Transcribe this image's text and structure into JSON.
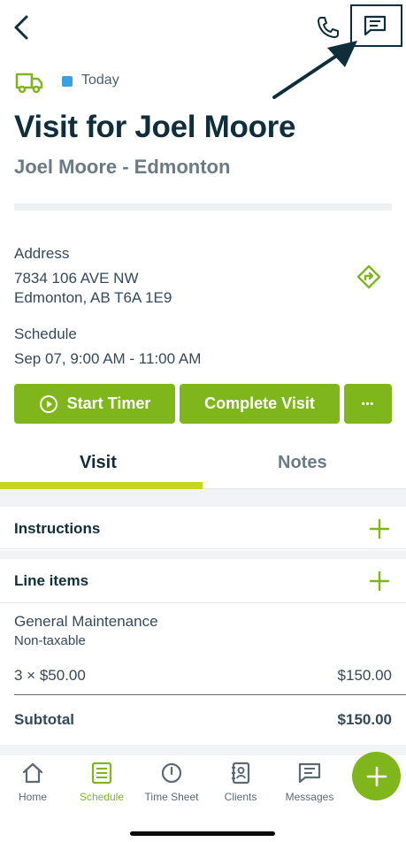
{
  "header": {
    "back_icon": "chevron-left-icon",
    "phone_icon": "phone-icon",
    "message_icon": "message-icon"
  },
  "visit": {
    "date_badge": "Today",
    "title": "Visit for Joel Moore",
    "subtitle": "Joel Moore - Edmonton"
  },
  "address": {
    "label": "Address",
    "line1": "7834 106 AVE NW",
    "line2": "Edmonton, AB T6A 1E9"
  },
  "schedule": {
    "label": "Schedule",
    "value": "Sep 07, 9:00 AM - 11:00 AM"
  },
  "actions": {
    "start_timer": "Start Timer",
    "complete_visit": "Complete Visit",
    "more": "•••"
  },
  "tabs": [
    {
      "label": "Visit",
      "active": true
    },
    {
      "label": "Notes",
      "active": false
    }
  ],
  "sections": {
    "instructions": "Instructions",
    "line_items": "Line items"
  },
  "line_items": [
    {
      "name": "General Maintenance",
      "tax": "Non-taxable",
      "qty_price": "3 × $50.00",
      "total": "$150.00"
    }
  ],
  "subtotal": {
    "label": "Subtotal",
    "value": "$150.00"
  },
  "nav": [
    {
      "label": "Home",
      "icon": "home-icon"
    },
    {
      "label": "Schedule",
      "icon": "schedule-icon",
      "active": true
    },
    {
      "label": "Time Sheet",
      "icon": "clock-icon"
    },
    {
      "label": "Clients",
      "icon": "contacts-icon"
    },
    {
      "label": "Messages",
      "icon": "message-icon"
    }
  ],
  "colors": {
    "accent": "#7fb61c",
    "primary_text": "#0f2e3c",
    "tab_underline": "#c6d51f",
    "today_badge": "#3aa1e0"
  }
}
